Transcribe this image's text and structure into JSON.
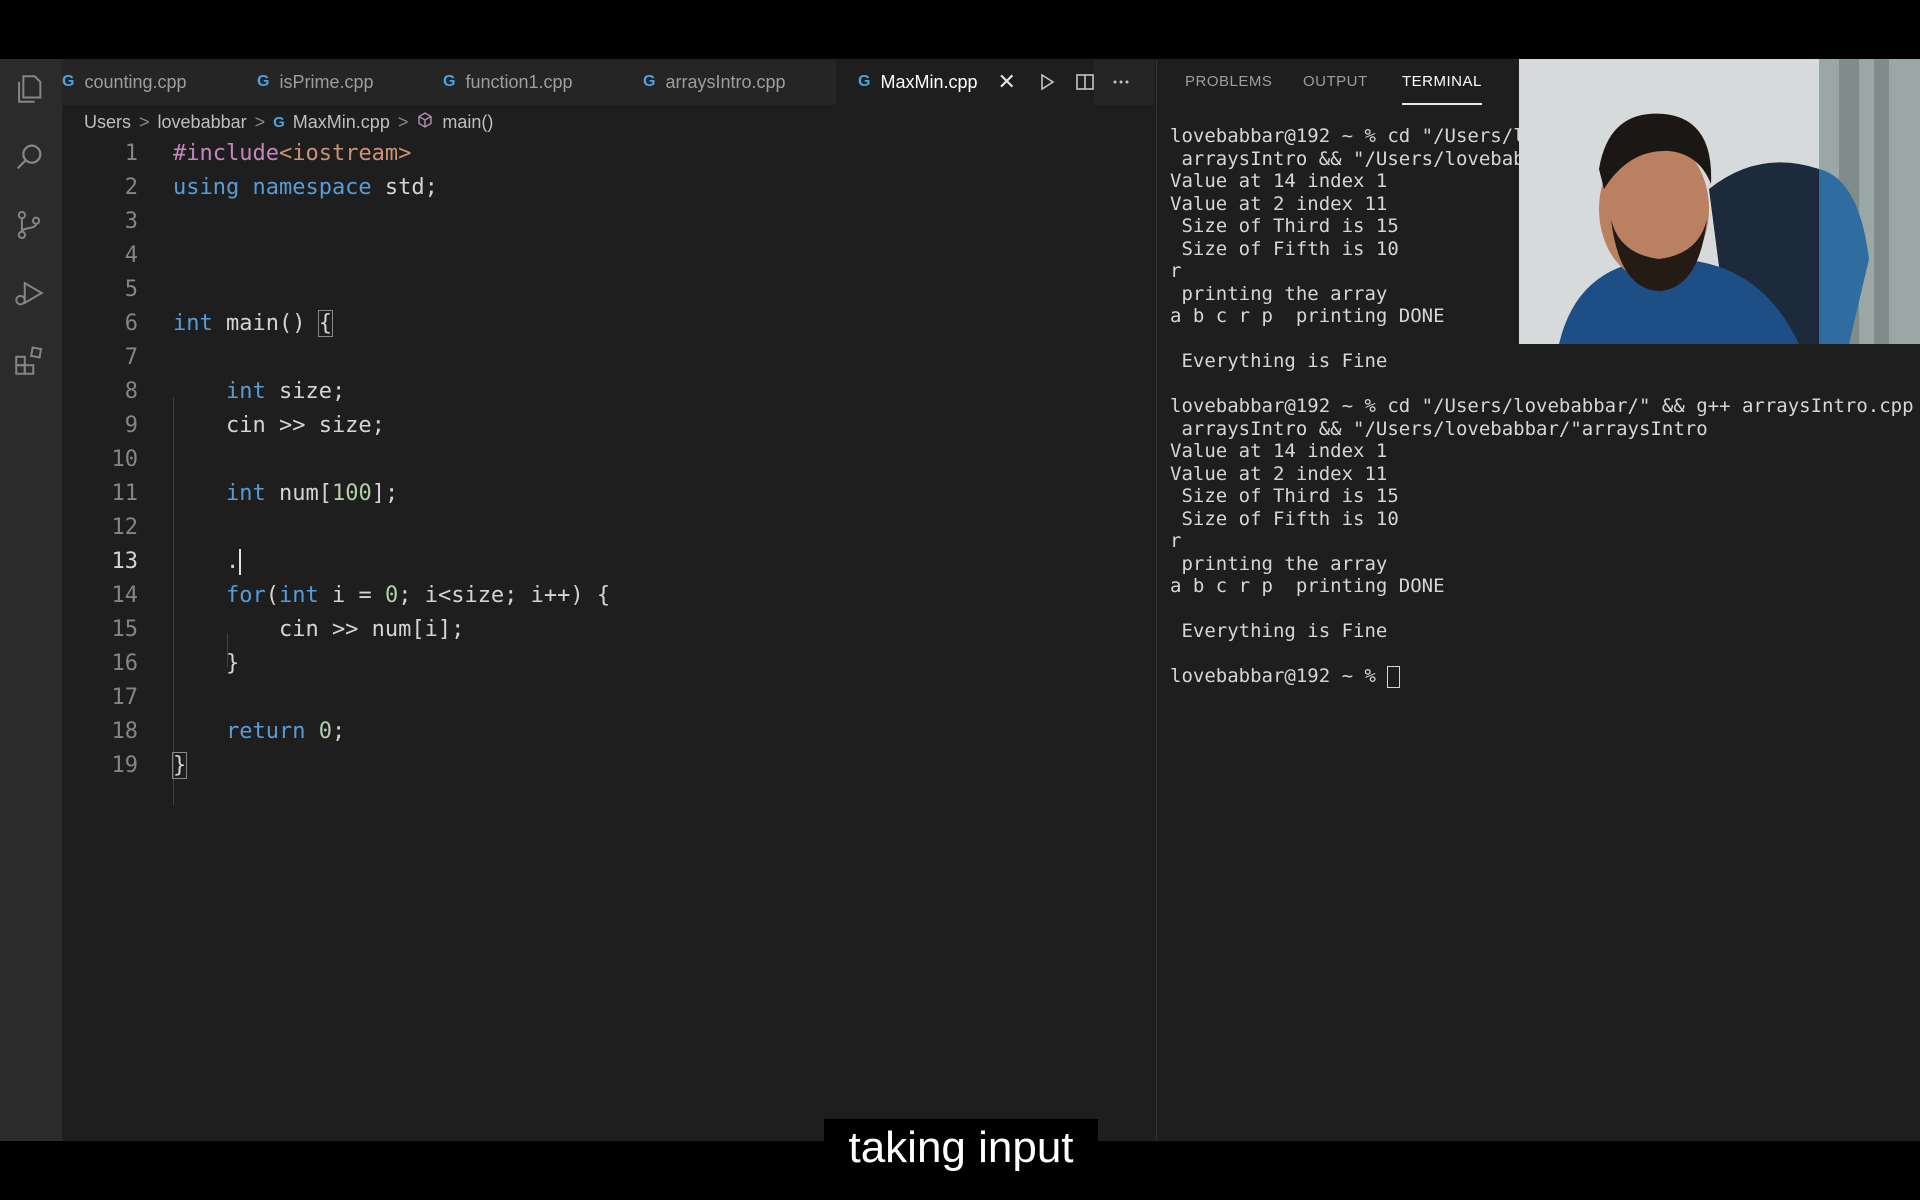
{
  "tabs": [
    {
      "name": "counting.cpp"
    },
    {
      "name": "isPrime.cpp"
    },
    {
      "name": "function1.cpp"
    },
    {
      "name": "arraysIntro.cpp"
    },
    {
      "name": "MaxMin.cpp",
      "active": true
    }
  ],
  "tab_icon_glyph": "G",
  "tab_close_glyph": "✕",
  "breadcrumb": {
    "items": [
      "Users",
      "lovebabbar",
      "MaxMin.cpp",
      "main()"
    ],
    "separator": ">"
  },
  "editor": {
    "current_line": 13,
    "line_numbers": [
      "1",
      "2",
      "3",
      "4",
      "5",
      "6",
      "7",
      "8",
      "9",
      "10",
      "11",
      "12",
      "13",
      "14",
      "15",
      "16",
      "17",
      "18",
      "19"
    ]
  },
  "panel": {
    "tabs": [
      "PROBLEMS",
      "OUTPUT",
      "TERMINAL"
    ],
    "active_tab": "TERMINAL",
    "terminal_lines": [
      "lovebabbar@192 ~ % cd \"/Users/l",
      " arraysIntro && \"/Users/lovebab",
      "Value at 14 index 1",
      "Value at 2 index 11",
      " Size of Third is 15",
      " Size of Fifth is 10",
      "r",
      " printing the array",
      "a b c r p  printing DONE",
      "",
      " Everything is Fine",
      "",
      "lovebabbar@192 ~ % cd \"/Users/lovebabbar/\" && g++ arraysIntro.cpp -",
      " arraysIntro && \"/Users/lovebabbar/\"arraysIntro",
      "Value at 14 index 1",
      "Value at 2 index 11",
      " Size of Third is 15",
      " Size of Fifth is 10",
      "r",
      " printing the array",
      "a b c r p  printing DONE",
      "",
      " Everything is Fine",
      "",
      "lovebabbar@192 ~ % "
    ]
  },
  "caption": "taking input",
  "colors": {
    "keyword": "#569cd6",
    "preprocessor": "#c586c0",
    "string": "#ce9178",
    "number": "#b5cea8",
    "background": "#1e1e1e"
  },
  "icons": [
    "files-icon",
    "search-icon",
    "source-control-icon",
    "run-debug-icon",
    "extensions-icon",
    "run-icon",
    "split-editor-icon",
    "more-icon",
    "function-cube-icon"
  ]
}
